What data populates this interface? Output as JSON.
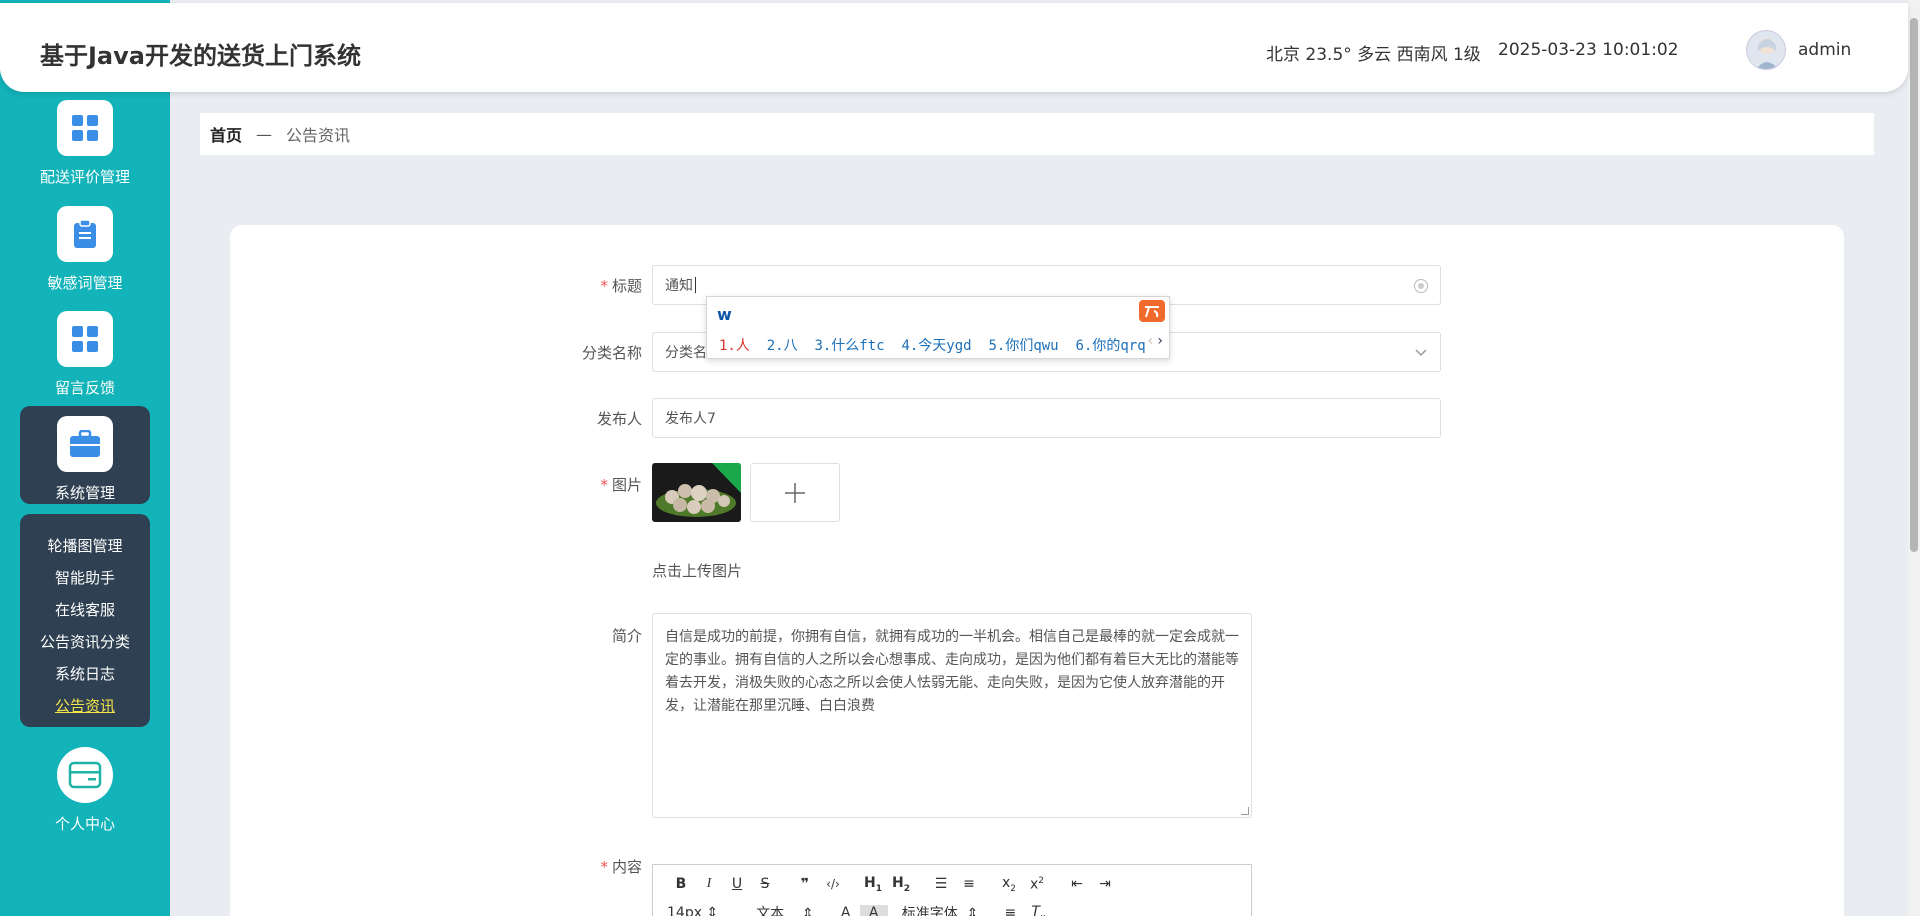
{
  "header": {
    "app_title": "基于Java开发的送货上门系统",
    "weather": "北京  23.5°  多云  西南风  1级",
    "datetime": "2025-03-23 10:01:02",
    "username": "admin"
  },
  "sidebar": {
    "items": [
      {
        "label": "配送评价管理",
        "icon": "grid-icon"
      },
      {
        "label": "敏感词管理",
        "icon": "clipboard-icon"
      },
      {
        "label": "留言反馈",
        "icon": "grid-icon"
      },
      {
        "label": "系统管理",
        "icon": "briefcase-icon"
      },
      {
        "label": "个人中心",
        "icon": "card-icon"
      }
    ],
    "submenu": [
      {
        "label": "轮播图管理"
      },
      {
        "label": "智能助手"
      },
      {
        "label": "在线客服"
      },
      {
        "label": "公告资讯分类"
      },
      {
        "label": "系统日志"
      },
      {
        "label": "公告资讯"
      }
    ]
  },
  "breadcrumb": {
    "home": "首页",
    "separator": "—",
    "current": "公告资讯"
  },
  "form": {
    "title_label": "标题",
    "title_value": "通知",
    "category_label": "分类名称",
    "category_value": "分类名",
    "publisher_label": "发布人",
    "publisher_value": "发布人7",
    "image_label": "图片",
    "upload_text": "点击上传图片",
    "intro_label": "简介",
    "intro_value": "自信是成功的前提，你拥有自信，就拥有成功的一半机会。相信自己是最棒的就一定会成就一定的事业。拥有自信的人之所以会心想事成、走向成功，是因为他们都有着巨大无比的潜能等着去开发，消极失败的心态之所以会使人怯弱无能、走向失败，是因为它使人放弃潜能的开发，让潜能在那里沉睡、白白浪费",
    "content_label": "内容",
    "required_mark": "*"
  },
  "ime": {
    "typed": "w",
    "candidates": [
      {
        "label": "1.人"
      },
      {
        "label": "2.八"
      },
      {
        "label": "3.什么ftc"
      },
      {
        "label": "4.今天ygd"
      },
      {
        "label": "5.你们qwu"
      },
      {
        "label": "6.你的qrq"
      }
    ]
  },
  "editor": {
    "font_size": "14px",
    "text_type": "文本",
    "font_family": "标准字体"
  },
  "colors": {
    "sidebar": "#12b3b9",
    "sidebar_active": "#2e4051",
    "submenu_active": "#f6e44b",
    "required": "#e55555"
  }
}
